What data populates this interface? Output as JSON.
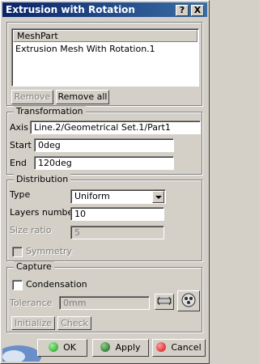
{
  "window": {
    "title": "Extrusion with Rotation",
    "help_btn": "?",
    "close_btn": "X"
  },
  "list": {
    "header": "MeshPart",
    "items": [
      "Extrusion Mesh With Rotation.1"
    ]
  },
  "list_buttons": {
    "remove": "Remove",
    "remove_all": "Remove all"
  },
  "transformation": {
    "title": "Transformation",
    "axis_label": "Axis",
    "axis_value": "Line.2/Geometrical Set.1/Part1",
    "start_label": "Start",
    "start_value": "0deg",
    "end_label": "End",
    "end_value": "120deg"
  },
  "distribution": {
    "title": "Distribution",
    "type_label": "Type",
    "type_value": "Uniform",
    "layers_label": "Layers number",
    "layers_value": "10",
    "size_ratio_label": "Size ratio",
    "size_ratio_value": "5",
    "symmetry_label": "Symmetry"
  },
  "capture": {
    "title": "Capture",
    "condensation_label": "Condensation",
    "tolerance_label": "Tolerance",
    "tolerance_value": "0mm",
    "initialize": "Initialize",
    "check": "Check"
  },
  "footer": {
    "ok": "OK",
    "apply": "Apply",
    "cancel": "Cancel"
  },
  "colors": {
    "title_start": "#0a246a",
    "title_end": "#3a6ea5",
    "ok_dot": "#1a9a1a",
    "apply_dot": "#1a5a1a",
    "cancel_dot": "#d01010"
  }
}
